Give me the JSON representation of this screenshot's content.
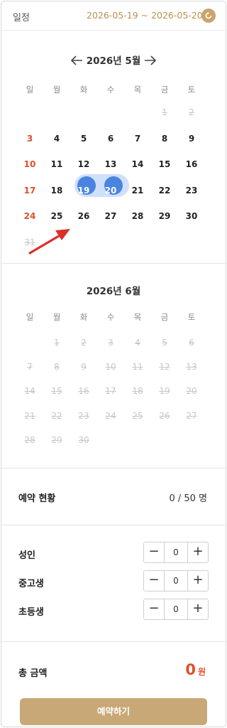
{
  "header": {
    "label": "일정",
    "date_range": "2026-05-19 ~ 2026-05-20",
    "reset_icon": "refresh-icon"
  },
  "calendar": {
    "weekdays": [
      "일",
      "월",
      "화",
      "수",
      "목",
      "금",
      "토"
    ],
    "months": [
      {
        "title": "2026년 5월",
        "prev_icon": "arrow-left-icon",
        "next_icon": "arrow-right-icon",
        "weeks": [
          [
            "",
            "",
            "",
            "",
            "",
            "1",
            "2"
          ],
          [
            "3",
            "4",
            "5",
            "6",
            "7",
            "8",
            "9"
          ],
          [
            "10",
            "11",
            "12",
            "13",
            "14",
            "15",
            "16"
          ],
          [
            "17",
            "18",
            "19",
            "20",
            "21",
            "22",
            "23"
          ],
          [
            "24",
            "25",
            "26",
            "27",
            "28",
            "29",
            "30"
          ],
          [
            "31",
            "",
            "",
            "",
            "",
            "",
            ""
          ]
        ],
        "disabled": [
          "1",
          "2",
          "31"
        ],
        "selected": [
          "19",
          "20"
        ]
      },
      {
        "title": "2026년 6월",
        "weeks": [
          [
            "",
            "1",
            "2",
            "3",
            "4",
            "5",
            "6"
          ],
          [
            "7",
            "8",
            "9",
            "10",
            "11",
            "12",
            "13"
          ],
          [
            "14",
            "15",
            "16",
            "17",
            "18",
            "19",
            "20"
          ],
          [
            "21",
            "22",
            "23",
            "24",
            "25",
            "26",
            "27"
          ],
          [
            "28",
            "29",
            "30",
            "",
            "",
            "",
            ""
          ]
        ],
        "all_disabled": true
      }
    ]
  },
  "status": {
    "label": "예약 현황",
    "value": "0 / 50 명"
  },
  "people": [
    {
      "label": "성인",
      "count": "0",
      "minus": "−",
      "plus": "+"
    },
    {
      "label": "중고생",
      "count": "0",
      "minus": "−",
      "plus": "+"
    },
    {
      "label": "초등생",
      "count": "0",
      "minus": "−",
      "plus": "+"
    }
  ],
  "total": {
    "label": "총 금액",
    "amount": "0",
    "unit": "원"
  },
  "book_button": {
    "label": "예약하기"
  },
  "colors": {
    "accent": "#c8a877",
    "selected": "#4a84e0",
    "sunday": "#e0502a",
    "annotation_arrow": "#d9302a"
  }
}
